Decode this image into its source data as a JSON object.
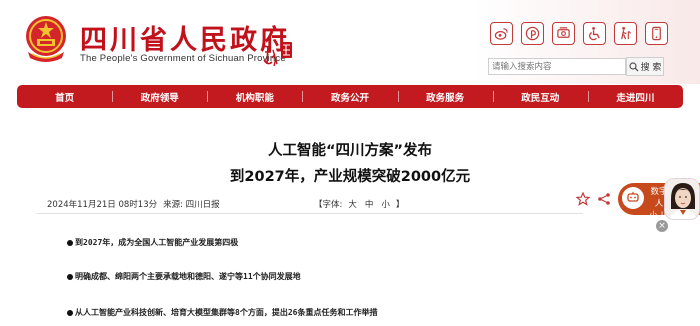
{
  "header": {
    "title": "四川省人民政府",
    "subtitle": "The People's Government of Sichuan Province",
    "icons": [
      "weibo-icon",
      "pinterest-icon",
      "phone-icon",
      "accessibility-icon",
      "elder-care-icon",
      "mobile-icon"
    ]
  },
  "search": {
    "placeholder": "请输入搜索内容",
    "button_label": "搜 索"
  },
  "nav": {
    "items": [
      {
        "label": "首页"
      },
      {
        "label": "政府领导"
      },
      {
        "label": "机构职能"
      },
      {
        "label": "政务公开"
      },
      {
        "label": "政务服务"
      },
      {
        "label": "政民互动"
      },
      {
        "label": "走进四川"
      }
    ]
  },
  "article": {
    "title_line1": "人工智能“四川方案”发布",
    "title_line2": "到2027年，产业规模突破2000亿元",
    "date": "2024年11月21日 08时13分",
    "source": "来源: 四川日报",
    "font_size_label": "【字体:",
    "font_large": "大",
    "font_medium": "中",
    "font_small": "小",
    "font_close": "】",
    "bullets": [
      "到2027年，成为全国人工智能产业发展第四极",
      "明确成都、绵阳两个主要承载地和德阳、遂宁等11个协同发展地",
      "从人工智能产业科技创新、培育大模型集群等8个方面，提出26条重点任务和工作举措"
    ]
  },
  "assistant": {
    "line1": "数字人",
    "line2": "小 川",
    "close": "×"
  },
  "colors": {
    "brand_red": "#c21a1f",
    "title_red": "#c1121c",
    "assistant_orange": "#c74a1d"
  }
}
